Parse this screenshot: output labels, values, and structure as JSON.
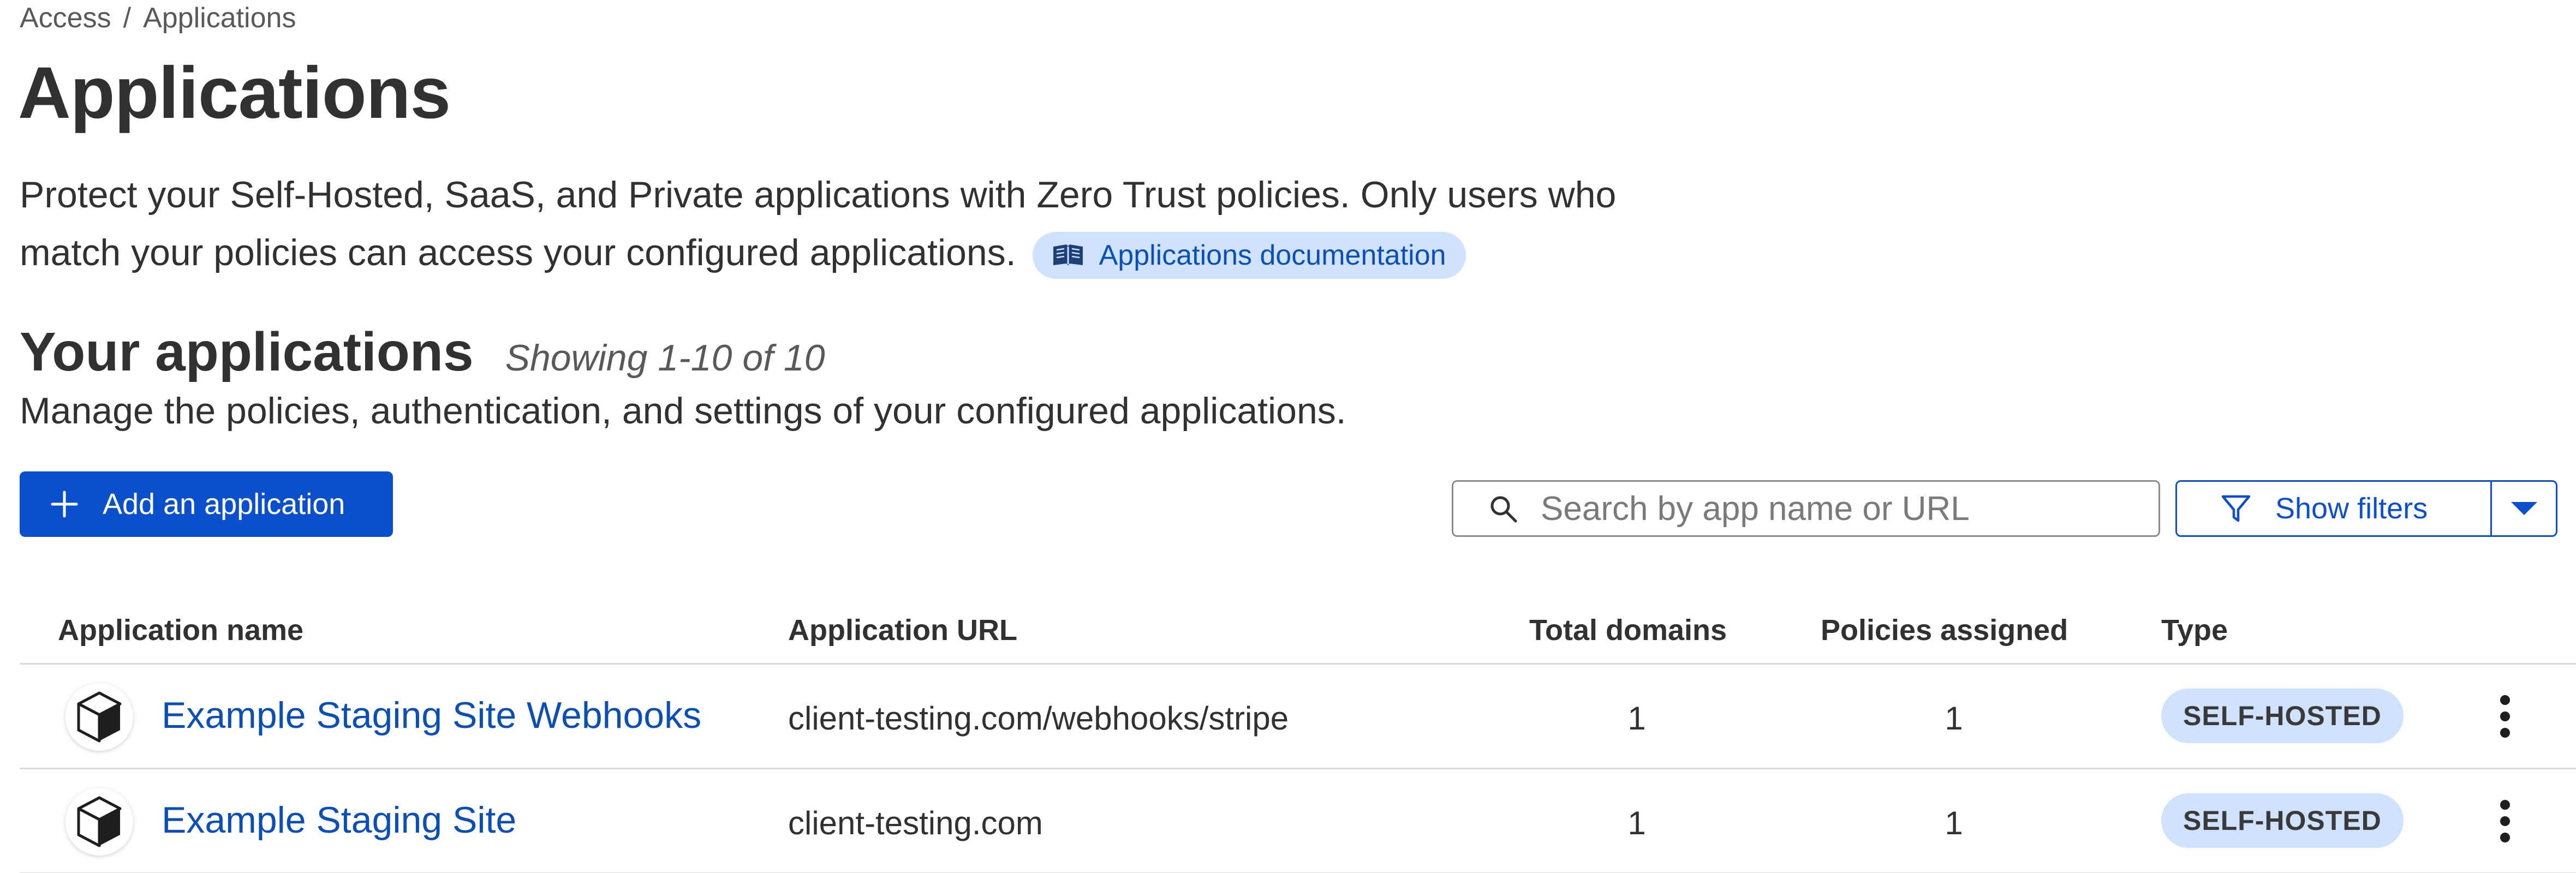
{
  "breadcrumb": {
    "items": [
      "Access",
      "Applications"
    ],
    "separator": "/"
  },
  "page": {
    "title": "Applications",
    "description": "Protect your Self-Hosted, SaaS, and Private applications with Zero Trust policies. Only users who match your policies can access your configured applications.",
    "doc_link_label": "Applications documentation"
  },
  "section": {
    "title": "Your applications",
    "count_text": "Showing 1-10 of 10",
    "subtitle": "Manage the policies, authentication, and settings of your configured applications."
  },
  "toolbar": {
    "add_label": "Add an application",
    "search_placeholder": "Search by app name or URL",
    "filters_label": "Show filters"
  },
  "table": {
    "headers": [
      "Application name",
      "Application URL",
      "Total domains",
      "Policies assigned",
      "Type"
    ],
    "rows": [
      {
        "name": "Example Staging Site Webhooks",
        "url": "client-testing.com/webhooks/stripe",
        "total_domains": "1",
        "policies": "1",
        "type": "SELF-HOSTED"
      },
      {
        "name": "Example Staging Site",
        "url": "client-testing.com",
        "total_domains": "1",
        "policies": "1",
        "type": "SELF-HOSTED"
      }
    ]
  },
  "icons": {
    "doc": "book-icon",
    "add": "plus-icon",
    "search": "search-icon",
    "filter": "filter-icon",
    "caret": "chevron-down-icon",
    "app": "cube-icon",
    "menu": "kebab-menu-icon"
  },
  "colors": {
    "accent": "#0b4fcc",
    "link": "#0b4fb4",
    "badge_bg": "#cfe2ff",
    "text": "#313131"
  }
}
